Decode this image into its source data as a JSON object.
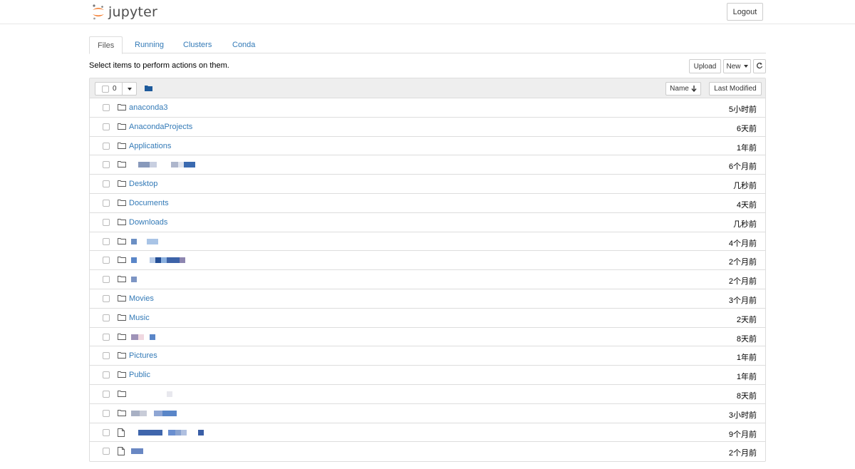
{
  "app": {
    "name": "jupyter",
    "logout_label": "Logout"
  },
  "tabs": [
    {
      "label": "Files",
      "active": true
    },
    {
      "label": "Running",
      "active": false
    },
    {
      "label": "Clusters",
      "active": false
    },
    {
      "label": "Conda",
      "active": false
    }
  ],
  "toolbar": {
    "instruction": "Select items to perform actions on them.",
    "upload_label": "Upload",
    "new_label": "New",
    "refresh_icon": "refresh-icon"
  },
  "list_header": {
    "selected_count": "0",
    "sort_name_label": "Name",
    "sort_name_icon": "arrow-down-icon",
    "last_modified_label": "Last Modified"
  },
  "items": [
    {
      "type": "folder",
      "name": "anaconda3",
      "modified": "5小时前"
    },
    {
      "type": "folder",
      "name": "AnacondaProjects",
      "modified": "6天前"
    },
    {
      "type": "folder",
      "name": "Applications",
      "modified": "1年前"
    },
    {
      "type": "folder",
      "name": "",
      "obscured": true,
      "modified": "6个月前"
    },
    {
      "type": "folder",
      "name": "Desktop",
      "modified": "几秒前"
    },
    {
      "type": "folder",
      "name": "Documents",
      "modified": "4天前"
    },
    {
      "type": "folder",
      "name": "Downloads",
      "modified": "几秒前"
    },
    {
      "type": "folder",
      "name": "",
      "obscured": true,
      "modified": "4个月前"
    },
    {
      "type": "folder",
      "name": "",
      "obscured": true,
      "modified": "2个月前"
    },
    {
      "type": "folder",
      "name": "",
      "obscured": true,
      "modified": "2个月前"
    },
    {
      "type": "folder",
      "name": "Movies",
      "modified": "3个月前"
    },
    {
      "type": "folder",
      "name": "Music",
      "modified": "2天前"
    },
    {
      "type": "folder",
      "name": "",
      "obscured": true,
      "modified": "8天前"
    },
    {
      "type": "folder",
      "name": "Pictures",
      "modified": "1年前"
    },
    {
      "type": "folder",
      "name": "Public",
      "modified": "1年前"
    },
    {
      "type": "folder",
      "name": "",
      "obscured": true,
      "modified": "8天前"
    },
    {
      "type": "folder",
      "name": "",
      "obscured": true,
      "modified": "3小时前"
    },
    {
      "type": "file",
      "name": "",
      "obscured": true,
      "modified": "9个月前"
    },
    {
      "type": "file",
      "name": "",
      "obscured": true,
      "modified": "2个月前"
    }
  ],
  "colors": {
    "link": "#337ab7",
    "header_bg": "#eeeeee",
    "border": "#dddddd",
    "logo_orange": "#f37726"
  }
}
